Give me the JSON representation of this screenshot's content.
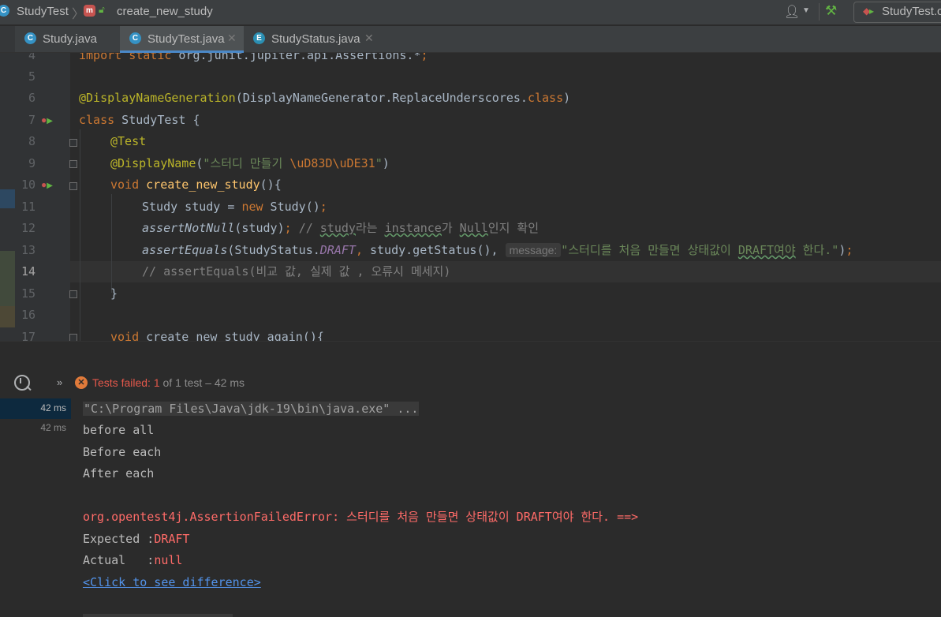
{
  "navbar": {
    "class_badge": "C",
    "class_name": "StudyTest",
    "method_badge": "m",
    "method_name": "create_new_study",
    "run_config": "StudyTest.c"
  },
  "tabs": [
    {
      "badge": "C",
      "label": "Study.java",
      "active": false
    },
    {
      "badge": "C",
      "label": "StudyTest.java",
      "active": true
    },
    {
      "badge": "E",
      "label": "StudyStatus.java",
      "active": false
    }
  ],
  "editor": {
    "line_numbers": [
      "4",
      "5",
      "6",
      "7",
      "8",
      "9",
      "10",
      "11",
      "12",
      "13",
      "14",
      "15",
      "16",
      "17"
    ],
    "current_line": "14",
    "code": {
      "l4_kw1": "import",
      "l4_kw2": "static",
      "l4_rest": " org.junit.jupiter.api.Assertions.*",
      "l6_ann": "@DisplayNameGeneration",
      "l6_open": "(DisplayNameGenerator.ReplaceUnderscores.",
      "l6_kw": "class",
      "l6_close": ")",
      "l7_kw": "class",
      "l7_rest": " StudyTest {",
      "l8_ann": "@Test",
      "l9_ann": "@DisplayName",
      "l9_open": "(",
      "l9_str": "\"스터디 만들기 ",
      "l9_esc": "\\uD83D\\uDE31",
      "l9_strend": "\"",
      "l9_close": ")",
      "l10_kw": "void",
      "l10_method": "create_new_study",
      "l10_rest": "(){",
      "l11_type": "Study study = ",
      "l11_kw": "new",
      "l11_rest": " Study()",
      "l12_fn": "assertNotNull",
      "l12_args": "(study)",
      "l12_cmt1": "// ",
      "l12_t1": "study",
      "l12_cmt2": "라는 ",
      "l12_t2": "instance",
      "l12_cmt3": "가 ",
      "l12_t3": "Null",
      "l12_cmt4": "인지 확인",
      "l13_fn": "assertEquals",
      "l13_a1": "(StudyStatus.",
      "l13_const": "DRAFT",
      "l13_a2": " study.getStatus(), ",
      "l13_hint": "message:",
      "l13_str1": "\"스터디를 처음 만들면 상태값이 ",
      "l13_strt": "DRAFT여야",
      "l13_str2": " 한다.\"",
      "l13_close": ")",
      "l14_cmt": "// assertEquals(비교 값, 실제 값 , 오류시 메세지)",
      "l15": "}",
      "l17_kw": "void",
      "l17_rest": " create_new_study_again(){"
    }
  },
  "run_panel": {
    "status_failed": "Tests failed: 1",
    "status_rest": " of 1 test – 42 ms",
    "tree_times": [
      "42 ms",
      "42 ms"
    ],
    "console": {
      "cmd": "\"C:\\Program Files\\Java\\jdk-19\\bin\\java.exe\" ...",
      "line1": "before all",
      "line2": "Before each",
      "line3": "After each",
      "error": "org.opentest4j.AssertionFailedError: 스터디를 처음 만들면 상태값이 DRAFT여야 한다. ==>",
      "expected_label": "Expected :",
      "expected_value": "DRAFT",
      "actual_label": "Actual   :",
      "actual_value": "null",
      "link": "<Click to see difference>"
    }
  },
  "colors": {
    "background": "#2b2b2b",
    "keyword": "#cc7832",
    "annotation": "#bbb529",
    "string": "#6a8759",
    "comment": "#808080",
    "error": "#ff6b68",
    "link": "#5394ec"
  }
}
